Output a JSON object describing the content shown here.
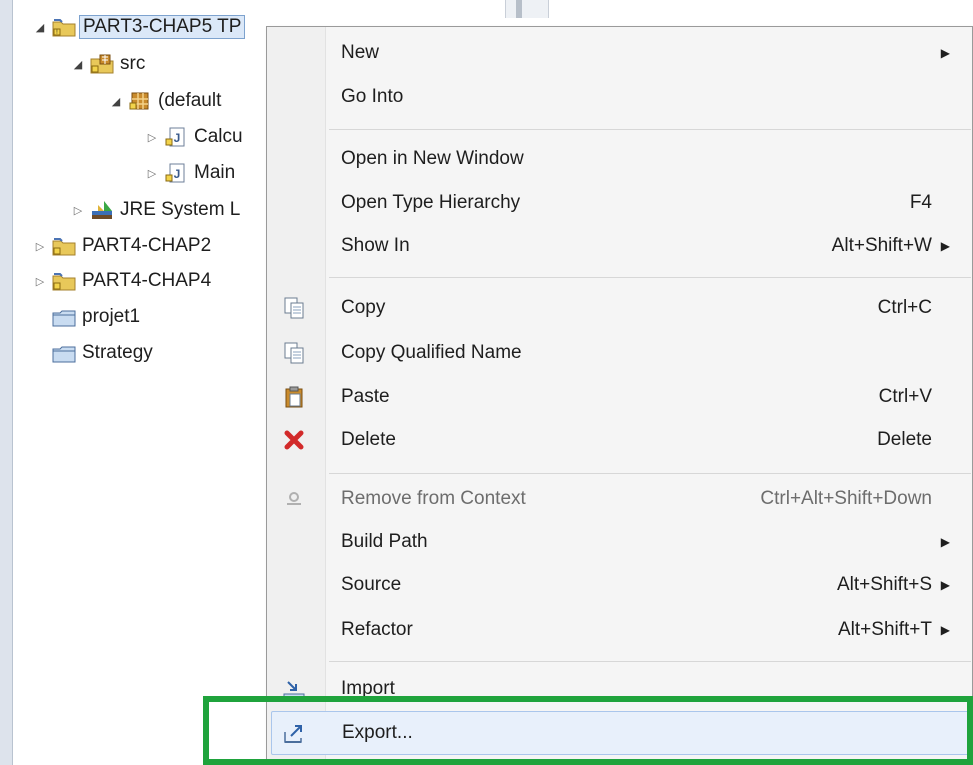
{
  "tree": {
    "items": [
      {
        "label": "PART3-CHAP5 TP",
        "icon": "java-project-icon"
      },
      {
        "label": "src",
        "icon": "source-folder-icon"
      },
      {
        "label": "(default",
        "icon": "package-icon"
      },
      {
        "label": "Calcu",
        "icon": "java-file-icon"
      },
      {
        "label": "Main",
        "icon": "java-file-icon"
      },
      {
        "label": "JRE System L",
        "icon": "library-icon"
      },
      {
        "label": "PART4-CHAP2",
        "icon": "java-project-icon"
      },
      {
        "label": "PART4-CHAP4",
        "icon": "java-project-icon"
      },
      {
        "label": "projet1",
        "icon": "closed-project-icon"
      },
      {
        "label": "Strategy",
        "icon": "closed-project-icon"
      }
    ]
  },
  "menu": {
    "items": [
      {
        "label": "New",
        "shortcut": "",
        "submenu": true
      },
      {
        "label": "Go Into",
        "shortcut": ""
      },
      {
        "label": "Open in New Window",
        "shortcut": ""
      },
      {
        "label": "Open Type Hierarchy",
        "shortcut": "F4"
      },
      {
        "label": "Show In",
        "shortcut": "Alt+Shift+W",
        "submenu": true
      },
      {
        "label": "Copy",
        "shortcut": "Ctrl+C",
        "icon": "copy-icon"
      },
      {
        "label": "Copy Qualified Name",
        "shortcut": "",
        "icon": "copy-qualified-name-icon"
      },
      {
        "label": "Paste",
        "shortcut": "Ctrl+V",
        "icon": "paste-icon"
      },
      {
        "label": "Delete",
        "shortcut": "Delete",
        "icon": "delete-icon"
      },
      {
        "label": "Remove from Context",
        "shortcut": "Ctrl+Alt+Shift+Down",
        "disabled": true,
        "icon": "remove-context-icon"
      },
      {
        "label": "Build Path",
        "shortcut": "",
        "submenu": true
      },
      {
        "label": "Source",
        "shortcut": "Alt+Shift+S",
        "submenu": true
      },
      {
        "label": "Refactor",
        "shortcut": "Alt+Shift+T",
        "submenu": true
      },
      {
        "label": "Import",
        "shortcut": "",
        "icon": "import-icon"
      },
      {
        "label": "Export...",
        "shortcut": "",
        "icon": "export-icon",
        "highlighted": true
      }
    ]
  },
  "colors": {
    "highlight_box": "#1fa33c",
    "menu_hover": "#e8f0fb",
    "tree_selection": "#dbe8f8"
  }
}
